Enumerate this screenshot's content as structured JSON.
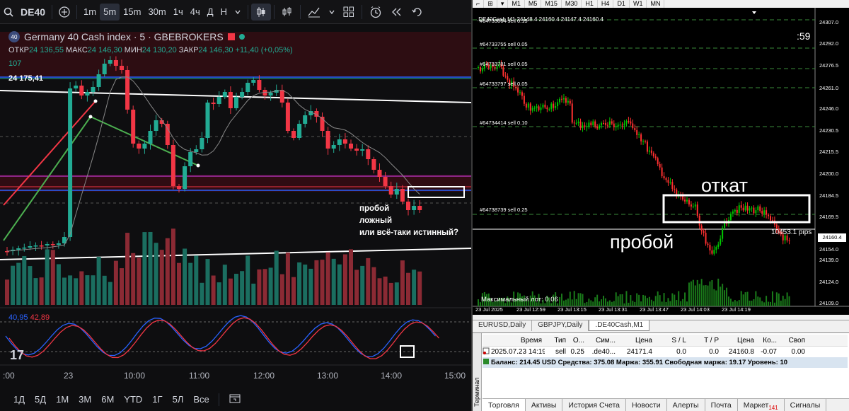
{
  "left": {
    "toolbar": {
      "symbol": "DE40",
      "timeframes": [
        "1m",
        "5m",
        "15m",
        "30m",
        "1ч",
        "4ч",
        "Д",
        "Н"
      ],
      "active_timeframe": "5m"
    },
    "legend": {
      "badge": "40",
      "title": "Germany 40 Cash index · 5 · GBEBROKERS"
    },
    "ohlc": {
      "open_label": "ОТКР",
      "open": "24 136,55",
      "high_label": "МАКС",
      "high": "24 146,30",
      "low_label": "МИН",
      "low": "24 130,20",
      "close_label": "ЗАКР",
      "close": "24 146,30",
      "change": "+11,40 (+0,05%)"
    },
    "volume_value": "107",
    "price_label": "24 175,41",
    "annotation": {
      "line1": "пробой",
      "line2": "ложный",
      "line3": "или всё-таки истинный?"
    },
    "oscillator": {
      "value_k": "40,95",
      "value_d": "42,89"
    },
    "logo": "17",
    "time_labels": [
      ":00",
      "23",
      "10:00",
      "11:00",
      "12:00",
      "13:00",
      "14:00",
      "15:00"
    ],
    "ranges": [
      "1Д",
      "5Д",
      "1М",
      "3М",
      "6М",
      "YTD",
      "1Г",
      "5Л",
      "Все"
    ],
    "colors": {
      "up": "#22ab94",
      "down": "#f23645",
      "bg": "#0e0e10"
    }
  },
  "right": {
    "toolbar_timeframes": [
      "M1",
      "M5",
      "M15",
      "M30",
      "H1",
      "H4",
      "D1",
      "W1",
      "MN"
    ],
    "chart_header": ".DE40Cash,M1 24148.4 24160.4 24147.4 24160.4",
    "timer": ":59",
    "orders": [
      "#64733664 sell 0.15",
      "#64733755 sell 0.05",
      "#64733781 sell 0.05",
      "#64733797 sell 0.05",
      "#64734414 sell 0.10",
      "#64738739 sell 0.25"
    ],
    "max_lot": "Максимальный лот: 0.06",
    "word_pullback": "откат",
    "word_breakout": "пробой",
    "pips_label": "10453.1 pips",
    "price_axis": [
      "24307.0",
      "24292.0",
      "24276.5",
      "24261.0",
      "24246.0",
      "24230.5",
      "24215.5",
      "24200.0",
      "24184.5",
      "24169.5",
      "24154.0",
      "24139.0",
      "24124.0",
      "24109.0"
    ],
    "current_price": "24160.4",
    "time_axis": [
      "23 Jul 2025",
      "23 Jul 12:59",
      "23 Jul 13:15",
      "23 Jul 13:31",
      "23 Jul 13:47",
      "23 Jul 14:03",
      "23 Jul 14:19"
    ],
    "chart_tabs": [
      "EURUSD,Daily",
      "GBPJPY,Daily",
      ".DE40Cash,M1"
    ],
    "active_chart_tab": ".DE40Cash,M1",
    "terminal": {
      "side_label": "Терминал",
      "headers": [
        "",
        "Время",
        "Тип",
        "О...",
        "Сим...",
        "Цена",
        "S / L",
        "T / P",
        "Цена",
        "Ко...",
        "Своп"
      ],
      "row": [
        "2025.07.23 14:19...",
        "sell",
        "0.25",
        ".de40...",
        "24171.4",
        "0.0",
        "0.0",
        "24160.8",
        "-0.07",
        "0.00"
      ],
      "balance_line": "Баланс: 214.45 USD  Средства: 375.08  Маржа: 355.91  Свободная маржа: 19.17  Уровень: 10",
      "tabs": [
        "Торговля",
        "Активы",
        "История Счета",
        "Новости",
        "Алерты",
        "Почта",
        "Маркет",
        "Сигналы"
      ],
      "market_count": "141",
      "active_tab": "Торговля"
    }
  }
}
